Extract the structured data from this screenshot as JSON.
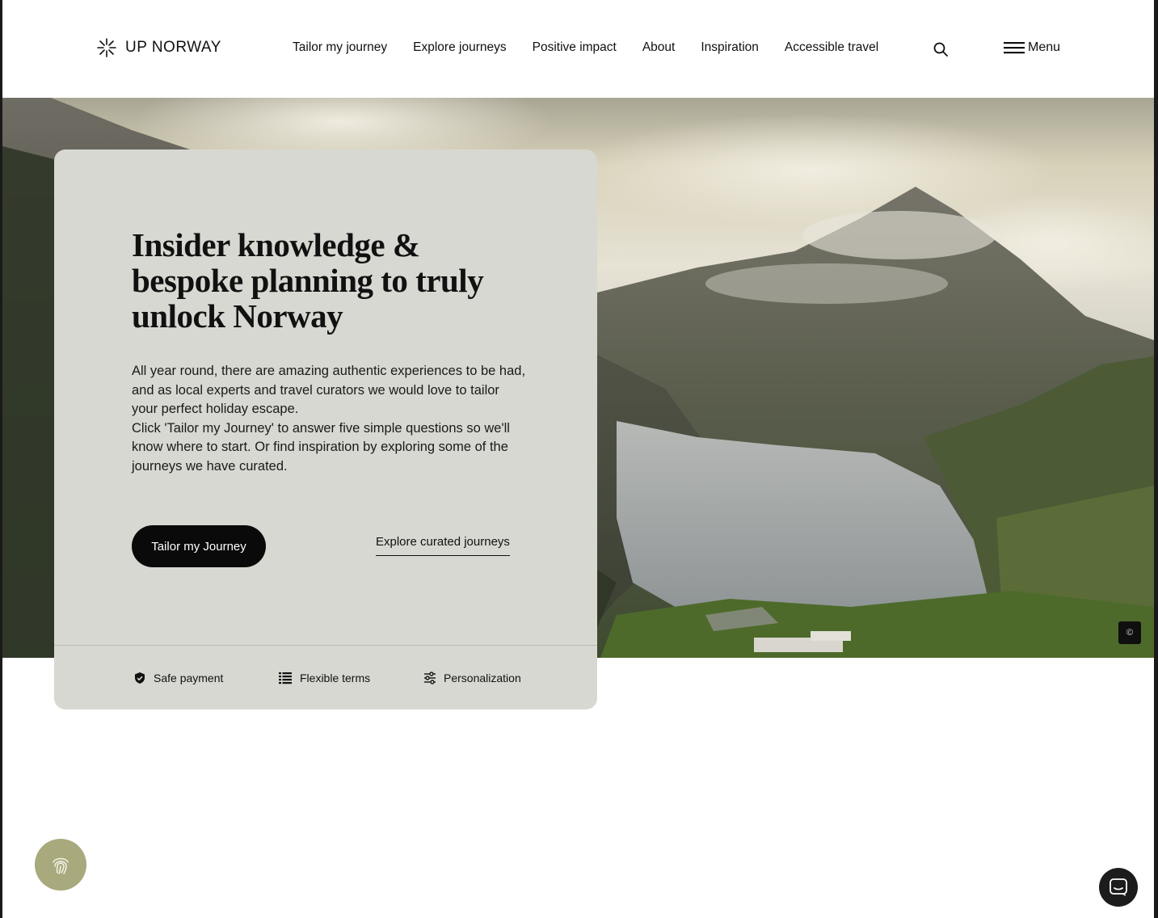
{
  "header": {
    "brand": "UP NORWAY",
    "nav": [
      "Tailor my journey",
      "Explore journeys",
      "Positive impact",
      "About",
      "Inspiration",
      "Accessible travel"
    ],
    "menu_label": "Menu",
    "icons": {
      "logo": "asterisk-logo-icon",
      "search": "search-icon",
      "menu": "hamburger-icon"
    }
  },
  "hero": {
    "title": "Insider knowledge & bespoke planning to truly unlock Norway",
    "paragraphs": [
      "All year round, there are amazing authentic experiences to be had, and as local experts and travel curators we would love to tailor your perfect holiday escape.",
      "Click 'Tailor my Journey' to answer five simple questions so we'll know where to start. Or find inspiration by exploring some of the journeys we have curated."
    ],
    "primary_cta": "Tailor my Journey",
    "secondary_cta": "Explore curated journeys",
    "copyright_symbol": "©",
    "features": [
      {
        "label": "Safe payment",
        "icon": "shield-check-icon"
      },
      {
        "label": "Flexible terms",
        "icon": "list-icon"
      },
      {
        "label": "Personalization",
        "icon": "sliders-icon"
      }
    ]
  },
  "widgets": {
    "cookie_icon": "fingerprint-icon",
    "chat_icon": "chat-bubble-icon"
  },
  "colors": {
    "card_bg": "#d8d8d2",
    "button_bg": "#0a0a0a",
    "cookie_bg": "#a8a97c",
    "chat_bg": "#1c1c1c"
  }
}
